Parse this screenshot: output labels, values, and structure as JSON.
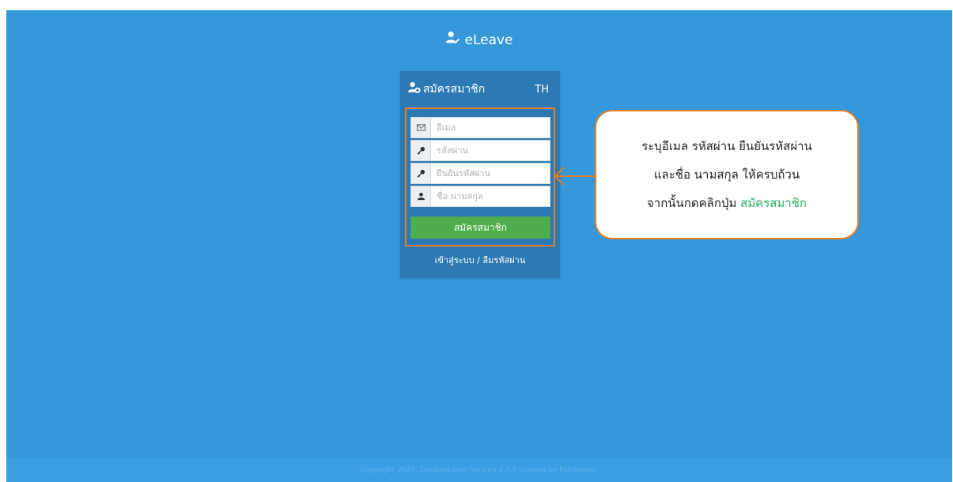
{
  "brand": {
    "name": "eLeave",
    "icon": "user-check-icon"
  },
  "register_panel": {
    "title": "สมัครสมาชิก",
    "language": "TH",
    "fields": {
      "email": {
        "placeholder": "อีเมล",
        "icon": "envelope-icon"
      },
      "password": {
        "placeholder": "รหัสผ่าน",
        "icon": "key-icon"
      },
      "confirm_password": {
        "placeholder": "ยืนยันรหัสผ่าน",
        "icon": "key-icon"
      },
      "name": {
        "placeholder": "ชื่อ นามสกุล",
        "icon": "user-icon"
      }
    },
    "submit_label": "สมัครสมาชิก",
    "links": {
      "login": "เข้าสู่ระบบ",
      "separator": "/",
      "forgot": "ลืมรหัสผ่าน"
    }
  },
  "callout": {
    "line1": "ระบุอีเมล รหัสผ่าน ยืนยันรหัสผ่าน",
    "line2": "และชื่อ นามสกุล ให้ครบถ้วน",
    "line3_prefix": "จากนั้นกดคลิกปุ่ม",
    "line3_highlight": "สมัครสมาชิก",
    "highlight_color": "#27ae60",
    "border_color": "#e67e22"
  },
  "footer": {
    "text": "Copyright 2020, Goragod.com Version 4.0.0 created by Kotchasan."
  },
  "colors": {
    "background": "#3498db",
    "panel": "#2d79b3",
    "submit": "#4cae4c"
  }
}
